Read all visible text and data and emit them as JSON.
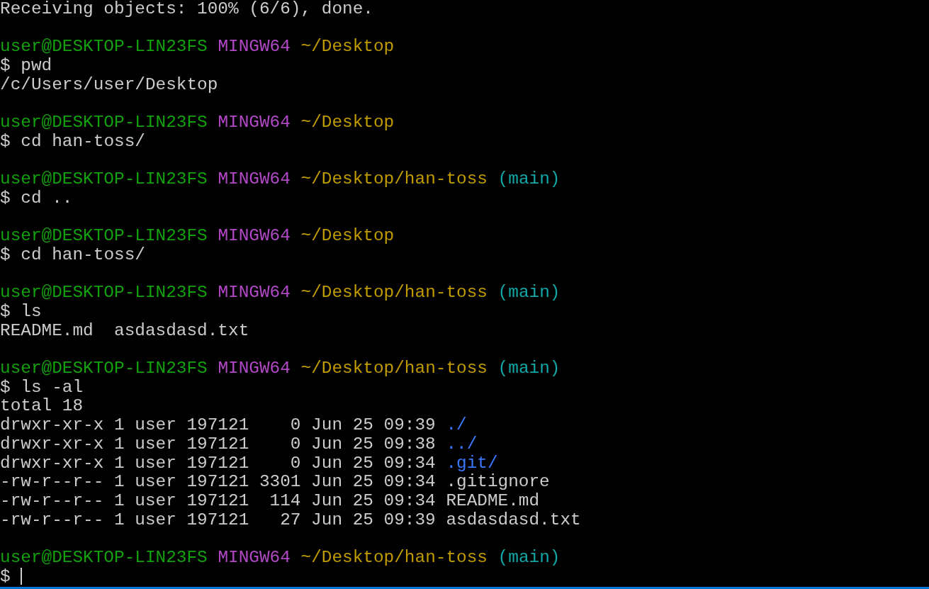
{
  "lines": [
    {
      "kind": "output",
      "text": "Receiving objects: 100% (6/6), done."
    },
    {
      "kind": "blank"
    },
    {
      "kind": "prompt",
      "user": "user@DESKTOP-LIN23FS",
      "system": "MINGW64",
      "path": "~/Desktop"
    },
    {
      "kind": "command",
      "prompt": "$",
      "command": "pwd"
    },
    {
      "kind": "output",
      "text": "/c/Users/user/Desktop"
    },
    {
      "kind": "blank"
    },
    {
      "kind": "prompt",
      "user": "user@DESKTOP-LIN23FS",
      "system": "MINGW64",
      "path": "~/Desktop"
    },
    {
      "kind": "command",
      "prompt": "$",
      "command": "cd han-toss/"
    },
    {
      "kind": "blank"
    },
    {
      "kind": "prompt",
      "user": "user@DESKTOP-LIN23FS",
      "system": "MINGW64",
      "path": "~/Desktop/han-toss",
      "branch": "(main)"
    },
    {
      "kind": "command",
      "prompt": "$",
      "command": "cd .."
    },
    {
      "kind": "blank"
    },
    {
      "kind": "prompt",
      "user": "user@DESKTOP-LIN23FS",
      "system": "MINGW64",
      "path": "~/Desktop"
    },
    {
      "kind": "command",
      "prompt": "$",
      "command": "cd han-toss/"
    },
    {
      "kind": "blank"
    },
    {
      "kind": "prompt",
      "user": "user@DESKTOP-LIN23FS",
      "system": "MINGW64",
      "path": "~/Desktop/han-toss",
      "branch": "(main)"
    },
    {
      "kind": "command",
      "prompt": "$",
      "command": "ls"
    },
    {
      "kind": "output",
      "text": "README.md  asdasdasd.txt"
    },
    {
      "kind": "blank"
    },
    {
      "kind": "prompt",
      "user": "user@DESKTOP-LIN23FS",
      "system": "MINGW64",
      "path": "~/Desktop/han-toss",
      "branch": "(main)"
    },
    {
      "kind": "command",
      "prompt": "$",
      "command": "ls -al"
    },
    {
      "kind": "output",
      "text": "total 18"
    },
    {
      "kind": "listing",
      "entry": "drwxr-xr-x 1 user 197121    0 Jun 25 09:39",
      "name": "./",
      "directory": true
    },
    {
      "kind": "listing",
      "entry": "drwxr-xr-x 1 user 197121    0 Jun 25 09:38",
      "name": "../",
      "directory": true
    },
    {
      "kind": "listing",
      "entry": "drwxr-xr-x 1 user 197121    0 Jun 25 09:34",
      "name": ".git/",
      "directory": true
    },
    {
      "kind": "listing",
      "entry": "-rw-r--r-- 1 user 197121 3301 Jun 25 09:34",
      "name": ".gitignore",
      "directory": false
    },
    {
      "kind": "listing",
      "entry": "-rw-r--r-- 1 user 197121  114 Jun 25 09:34",
      "name": "README.md",
      "directory": false
    },
    {
      "kind": "listing",
      "entry": "-rw-r--r-- 1 user 197121   27 Jun 25 09:39",
      "name": "asdasdasd.txt",
      "directory": false
    },
    {
      "kind": "blank"
    },
    {
      "kind": "prompt",
      "user": "user@DESKTOP-LIN23FS",
      "system": "MINGW64",
      "path": "~/Desktop/han-toss",
      "branch": "(main)"
    },
    {
      "kind": "command",
      "prompt": "$",
      "cursor": true
    }
  ]
}
